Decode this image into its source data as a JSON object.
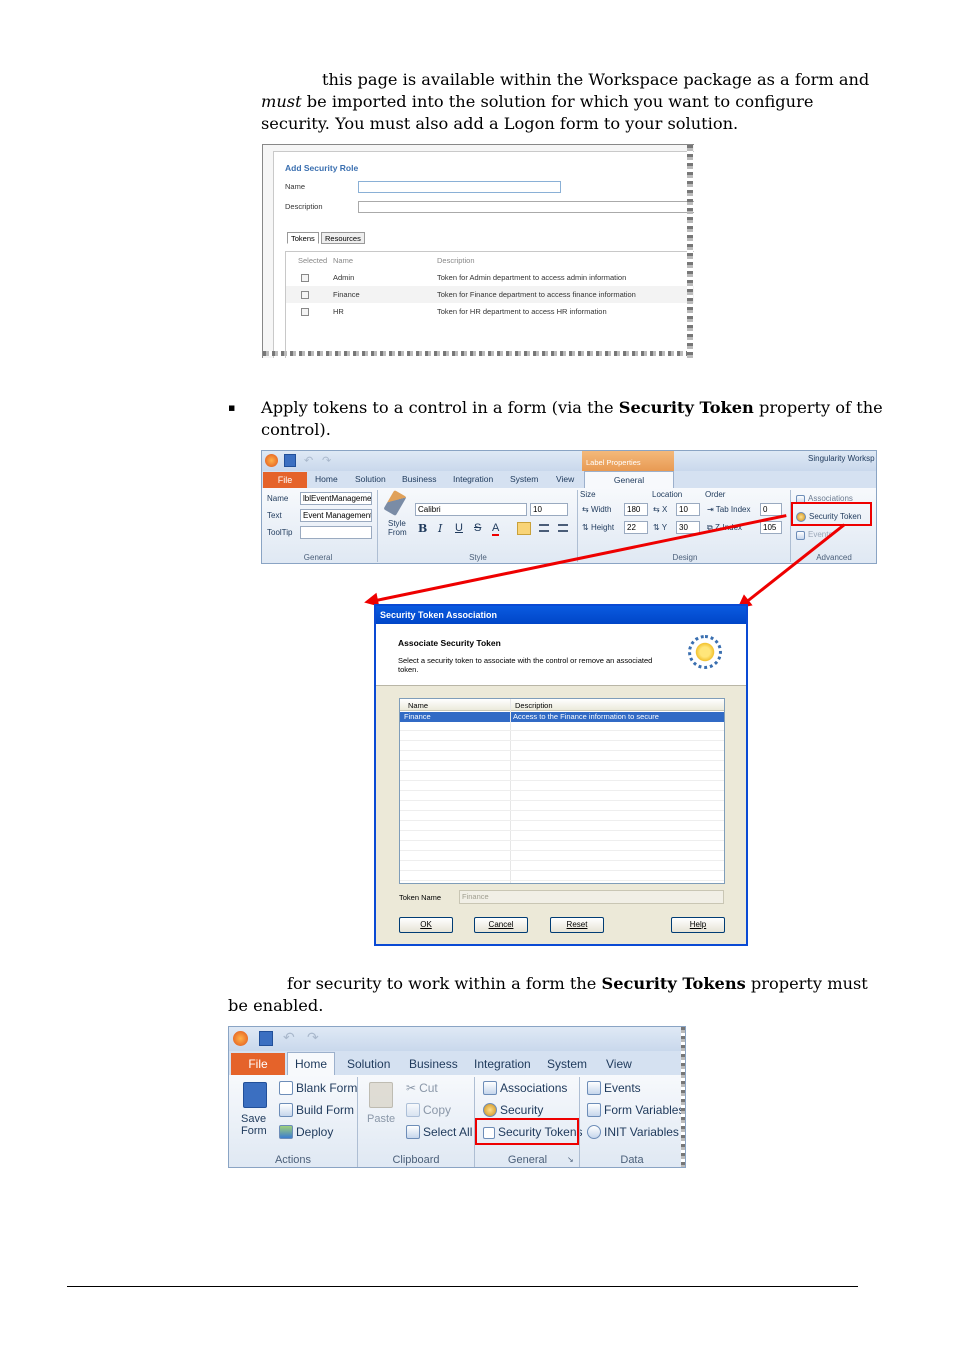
{
  "intro": {
    "line1": "this page is available within the Workspace package as a form and",
    "line2_em": "must",
    "line2_rest": " be imported into the solution for which you want to configure",
    "line3": "security. You must also add a Logon form to your solution."
  },
  "add_role": {
    "title": "Add Security Role",
    "name_label": "Name",
    "description_label": "Description",
    "tabs": [
      "Tokens",
      "Resources"
    ],
    "columns": [
      "Selected",
      "Name",
      "Description"
    ],
    "rows": [
      {
        "name": "Admin",
        "description": "Token for Admin department to access admin information"
      },
      {
        "name": "Finance",
        "description": "Token for Finance department to access finance information"
      },
      {
        "name": "HR",
        "description": "Token for HR department to access HR information"
      }
    ]
  },
  "bullet": {
    "marker": "▪",
    "pre": "Apply tokens to a control in a form (via the ",
    "bold": "Security Token",
    "post": " property of the",
    "line2": "control)."
  },
  "ribbon1": {
    "context_tab": "Label Properties",
    "app_title": "Singularity Worksp",
    "tabs": [
      "File",
      "Home",
      "Solution",
      "Business",
      "Integration",
      "System",
      "View"
    ],
    "active_tab": "General",
    "general": {
      "name_label": "Name",
      "name_value": "lblEventManageme",
      "text_label": "Text",
      "text_value": "Event Management",
      "tooltip_label": "ToolTip",
      "group": "General"
    },
    "style": {
      "style_from_1": "Style",
      "style_from_2": "From",
      "font": "Calibri",
      "size": "10",
      "format_buttons": [
        "B",
        "I",
        "U",
        "S",
        "A"
      ],
      "group": "Style"
    },
    "design": {
      "size_label": "Size",
      "location_label": "Location",
      "order_label": "Order",
      "width_label": "Width",
      "width": "180",
      "height_label": "Height",
      "height": "22",
      "x_label": "X",
      "x": "10",
      "y_label": "Y",
      "y": "30",
      "tab_index_label": "Tab Index",
      "tab_index": "0",
      "z_index_label": "Z-Index",
      "z_index": "105",
      "group": "Design"
    },
    "advanced": {
      "items": [
        "Associations",
        "Security Token",
        "Events"
      ],
      "group": "Advanced"
    }
  },
  "dialog": {
    "title": "Security Token Association",
    "heading": "Associate Security Token",
    "description": "Select a security token to associate with the control or remove an associated token.",
    "columns": [
      "Name",
      "Description"
    ],
    "selected_row": {
      "name": "Finance",
      "description": "Access to the Finance information to secure"
    },
    "token_name_label": "Token Name",
    "token_name_value": "Finance",
    "buttons": [
      "OK",
      "Cancel",
      "Reset",
      "Help"
    ]
  },
  "note": {
    "pre": "for security to work within a form the ",
    "bold": "Security Tokens",
    "post": " property must",
    "line2": "be enabled."
  },
  "ribbon2": {
    "tabs": [
      "File",
      "Home",
      "Solution",
      "Business",
      "Integration",
      "System",
      "View"
    ],
    "active_tab": "Home",
    "actions": {
      "save_1": "Save",
      "save_2": "Form",
      "items": [
        "Blank Form",
        "Build Form",
        "Deploy"
      ],
      "group": "Actions"
    },
    "clipboard": {
      "paste": "Paste",
      "items": [
        "Cut",
        "Copy",
        "Select All"
      ],
      "group": "Clipboard"
    },
    "general": {
      "items": [
        "Associations",
        "Security",
        "Security Tokens"
      ],
      "group": "General"
    },
    "data": {
      "items": [
        "Events",
        "Form Variables",
        "INIT Variables"
      ],
      "group": "Data"
    }
  },
  "colors": {
    "highlight": "#e00000",
    "file_tab": "#e5632a",
    "dialog_title": "#0a5ae0"
  }
}
